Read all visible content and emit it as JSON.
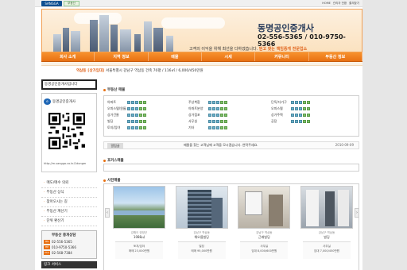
{
  "top": {
    "logo": "SANGGA",
    "badge": "부동산",
    "links": [
      "HOME",
      "관리자 전환",
      "즐겨찾기"
    ]
  },
  "header": {
    "office_name": "동명공인중개사",
    "phone": "02-556-5365 / 010-9750-5366",
    "slogan_pre": "고객의 이익을 위해 최선을 다하겠습니다.",
    "slogan_hl": "믿고 찾는 책임중개 전문업소"
  },
  "nav": [
    "회사 소개",
    "지역 정보",
    "매물",
    "시세",
    "커뮤니티",
    "부동산 정보"
  ],
  "ticker": {
    "tag": "역삼동",
    "label": "[상가임대]",
    "text": "서울특별시 강남구 역삼동 건축 70평 / 116㎡ / 6,000/450만원"
  },
  "sidebar": {
    "greeting": "동명공인중개사입니다",
    "qr_title": "동명공인중개사",
    "qr_url": "http://m.sangga.co.kr/1dongm",
    "menu": [
      "매도/매수 의뢰",
      "부동산 상식",
      "찾아오시는 길",
      "부동산 계산기",
      "단위 환산기"
    ],
    "contact_title": "부동산 중개상담",
    "contacts": [
      {
        "badge": "TEL",
        "value": "02-556-5365"
      },
      {
        "badge": "HP",
        "value": "010-9750-5366"
      },
      {
        "badge": "FAX",
        "value": "02-568-7384"
      }
    ],
    "links_title": "링크 서비스"
  },
  "main": {
    "cat_heading": "부동산 매물",
    "categories": [
      [
        "아파트",
        "주상복합",
        "단독/다가구"
      ],
      [
        "오피스텔/원룸/빌라",
        "아파트분양",
        "오피스텔"
      ],
      [
        "상가건물",
        "상가점포",
        "상가주택"
      ],
      [
        "빌딩",
        "사무실",
        "공장"
      ],
      [
        "토지/임야",
        "기타",
        ""
      ]
    ],
    "notice_label": "알림글",
    "notice_text": "매물을 찾는 고객님께 고객을 모시겠습니다. 연락주세요.",
    "notice_date": "2010-09-09",
    "focus_heading": "포커스매물",
    "photo_heading": "사진매물",
    "cards": [
      {
        "loc": "강원도 양양군",
        "title": "1088㎡",
        "kind": "토지/임야",
        "price": "매매 23,000만원"
      },
      {
        "loc": "강남구 역삼동",
        "title": "해오름빌딩",
        "kind": "빌딩",
        "price": "매매 95,000만원"
      },
      {
        "loc": "강남구 역삼동",
        "title": "근래빌딩",
        "kind": "사무실",
        "price": "임대 8,000/600만원"
      },
      {
        "loc": "강남구 역삼동",
        "title": "빌딩",
        "kind": "사무실",
        "price": "임대 7,000/450만원"
      }
    ]
  },
  "colors": {
    "accent": "#e87012",
    "header_bg": "#fbe2c0"
  }
}
